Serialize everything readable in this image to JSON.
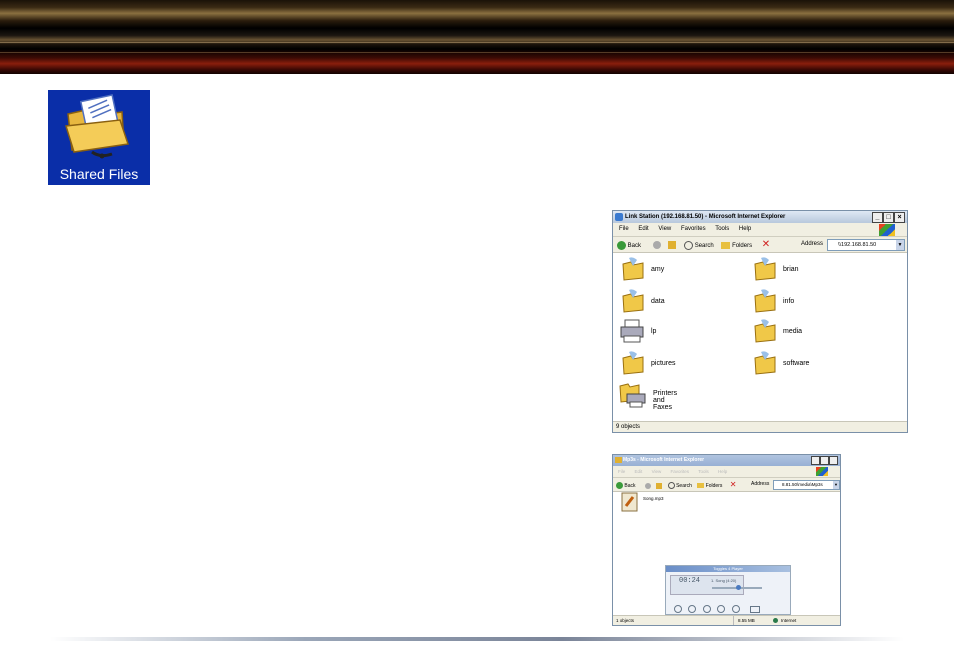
{
  "shared_files": {
    "label": "Shared Files"
  },
  "window1": {
    "title": "Link Station (192.168.81.50) - Microsoft Internet Explorer",
    "menu": [
      "File",
      "Edit",
      "View",
      "Favorites",
      "Tools",
      "Help"
    ],
    "toolbar": {
      "back": "Back",
      "search": "Search",
      "folders": "Folders",
      "address_label": "Address",
      "address_value": "\\\\192.168.81.50"
    },
    "items": [
      "amy",
      "brian",
      "data",
      "info",
      "lp",
      "media",
      "pictures",
      "software",
      "Printers and Faxes"
    ],
    "status": "9 objects"
  },
  "window2": {
    "title": "Mp3s - Microsoft Internet Explorer",
    "menu": [
      "File",
      "Edit",
      "View",
      "Favorites",
      "Tools",
      "Help"
    ],
    "toolbar": {
      "back": "Back",
      "search": "Search",
      "folders": "Folders",
      "address_label": "Address",
      "address_value": "8.81.50\\media\\Mp3s"
    },
    "file": "Song.mp3",
    "player": {
      "title": "Toggles 4 Player",
      "time": "00:24",
      "track": "1. Song (4:20)"
    },
    "status": "1 objects",
    "size": "8.55 MB",
    "zone": "Internet"
  }
}
